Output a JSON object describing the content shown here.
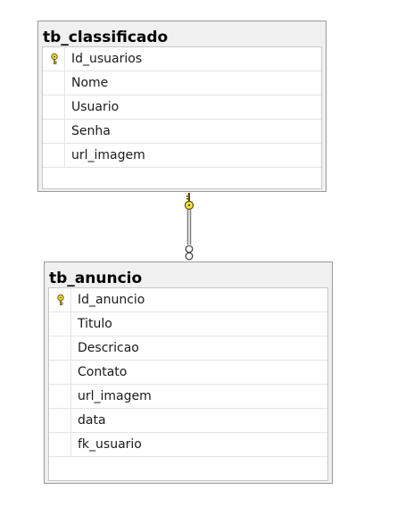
{
  "colors": {
    "table_bg": "#f0f0f0",
    "key_yellow": "#f5e642",
    "border": "#9a9a9a"
  },
  "tables": [
    {
      "title": "tb_classificado",
      "columns": [
        {
          "name": "Id_usuarios",
          "primary_key": true
        },
        {
          "name": "Nome",
          "primary_key": false
        },
        {
          "name": "Usuario",
          "primary_key": false
        },
        {
          "name": "Senha",
          "primary_key": false
        },
        {
          "name": "url_imagem",
          "primary_key": false
        }
      ]
    },
    {
      "title": "tb_anuncio",
      "columns": [
        {
          "name": "Id_anuncio",
          "primary_key": true
        },
        {
          "name": "Titulo",
          "primary_key": false
        },
        {
          "name": "Descricao",
          "primary_key": false
        },
        {
          "name": "Contato",
          "primary_key": false
        },
        {
          "name": "url_imagem",
          "primary_key": false
        },
        {
          "name": "data",
          "primary_key": false
        },
        {
          "name": "fk_usuario",
          "primary_key": false
        }
      ]
    }
  ],
  "relationship": {
    "from_table": "tb_classificado",
    "to_table": "tb_anuncio",
    "one_end_icon": "key-icon",
    "many_end_icon": "infinity-icon"
  }
}
